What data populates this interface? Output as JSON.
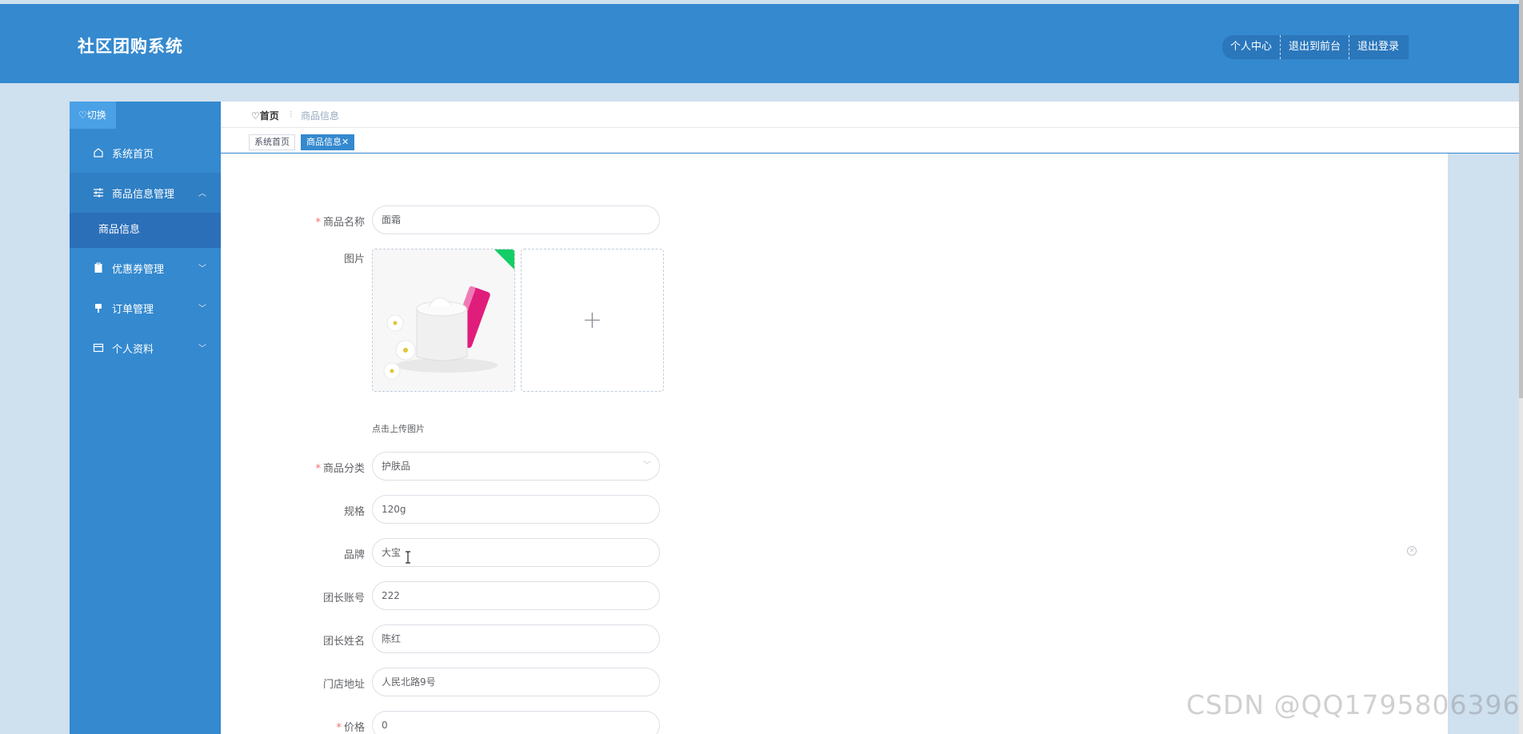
{
  "header": {
    "brand": "社区团购系统",
    "nav": [
      "个人中心",
      "退出到前台",
      "退出登录"
    ]
  },
  "sidebar": {
    "switch_label": "切换",
    "items": [
      {
        "label": "系统首页",
        "icon": "home-icon"
      },
      {
        "label": "商品信息管理",
        "icon": "sliders-icon",
        "expanded": true,
        "children": [
          "商品信息"
        ]
      },
      {
        "label": "优惠券管理",
        "icon": "clipboard-icon"
      },
      {
        "label": "订单管理",
        "icon": "pin-icon"
      },
      {
        "label": "个人资料",
        "icon": "wallet-icon"
      }
    ]
  },
  "breadcrumb": {
    "home": "首页",
    "separator": "⁝",
    "current": "商品信息"
  },
  "tags": [
    {
      "label": "系统首页",
      "active": false
    },
    {
      "label": "商品信息✕",
      "active": true
    }
  ],
  "form": {
    "fields": [
      {
        "label": "商品名称",
        "required": true,
        "value": "面霜"
      },
      {
        "label": "图片",
        "required": false
      },
      {
        "label": "商品分类",
        "required": true,
        "value": "护肤品",
        "type": "select"
      },
      {
        "label": "规格",
        "required": false,
        "value": "120g"
      },
      {
        "label": "品牌",
        "required": false,
        "value": "大宝"
      },
      {
        "label": "团长账号",
        "required": false,
        "value": "222"
      },
      {
        "label": "团长姓名",
        "required": false,
        "value": "陈红"
      },
      {
        "label": "门店地址",
        "required": false,
        "value": "人民北路9号"
      },
      {
        "label": "价格",
        "required": true,
        "value": "0"
      }
    ],
    "upload_hint": "点击上传图片",
    "required_mark": "*"
  },
  "watermark": "CSDN @QQ1795806396",
  "colors": {
    "primary": "#3489cf",
    "background": "#cfe0ef",
    "required": "#f56c6c",
    "upload_corner": "#13ce66"
  }
}
